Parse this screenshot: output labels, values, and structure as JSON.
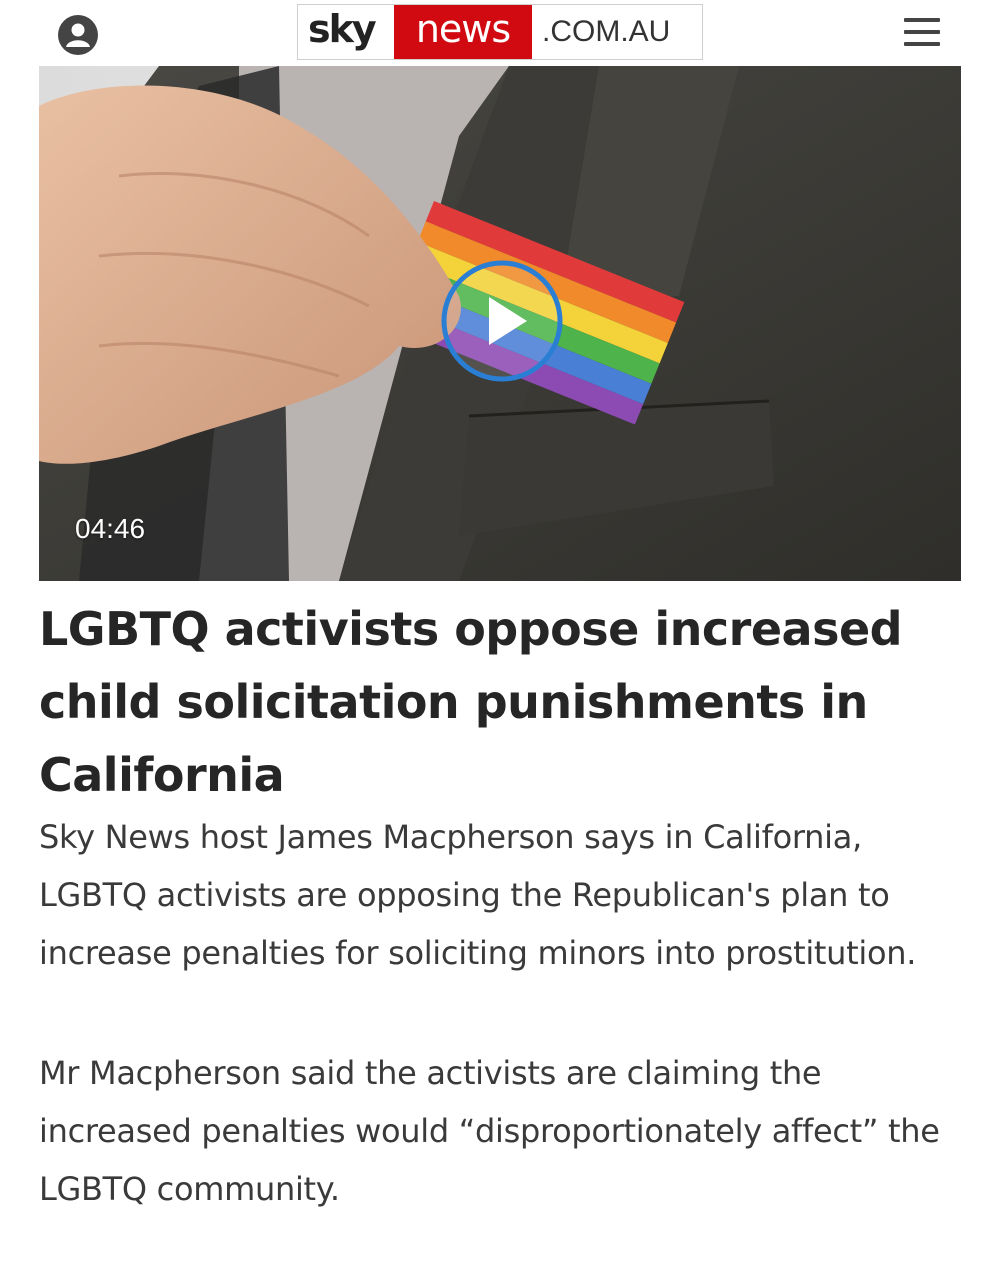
{
  "header": {
    "profile_icon": "user-circle-icon",
    "logo": {
      "sky": "sky",
      "news": "news",
      "domain": ".COM.AU"
    },
    "menu_icon": "hamburger-menu-icon",
    "brand_color": "#d10a11"
  },
  "video": {
    "duration": "04:46",
    "play_icon": "play-icon",
    "play_color": "#2a7fd4"
  },
  "article": {
    "headline": "LGBTQ activists oppose increased child solicitation punishments in California",
    "paragraphs": [
      "Sky News host James Macpherson says in California, LGBTQ activists are opposing the Republican's plan to increase penalties for soliciting minors into prostitution.",
      "Mr Macpherson said the activists are claiming the increased penalties would “disproportionately affect” the LGBTQ community."
    ]
  }
}
